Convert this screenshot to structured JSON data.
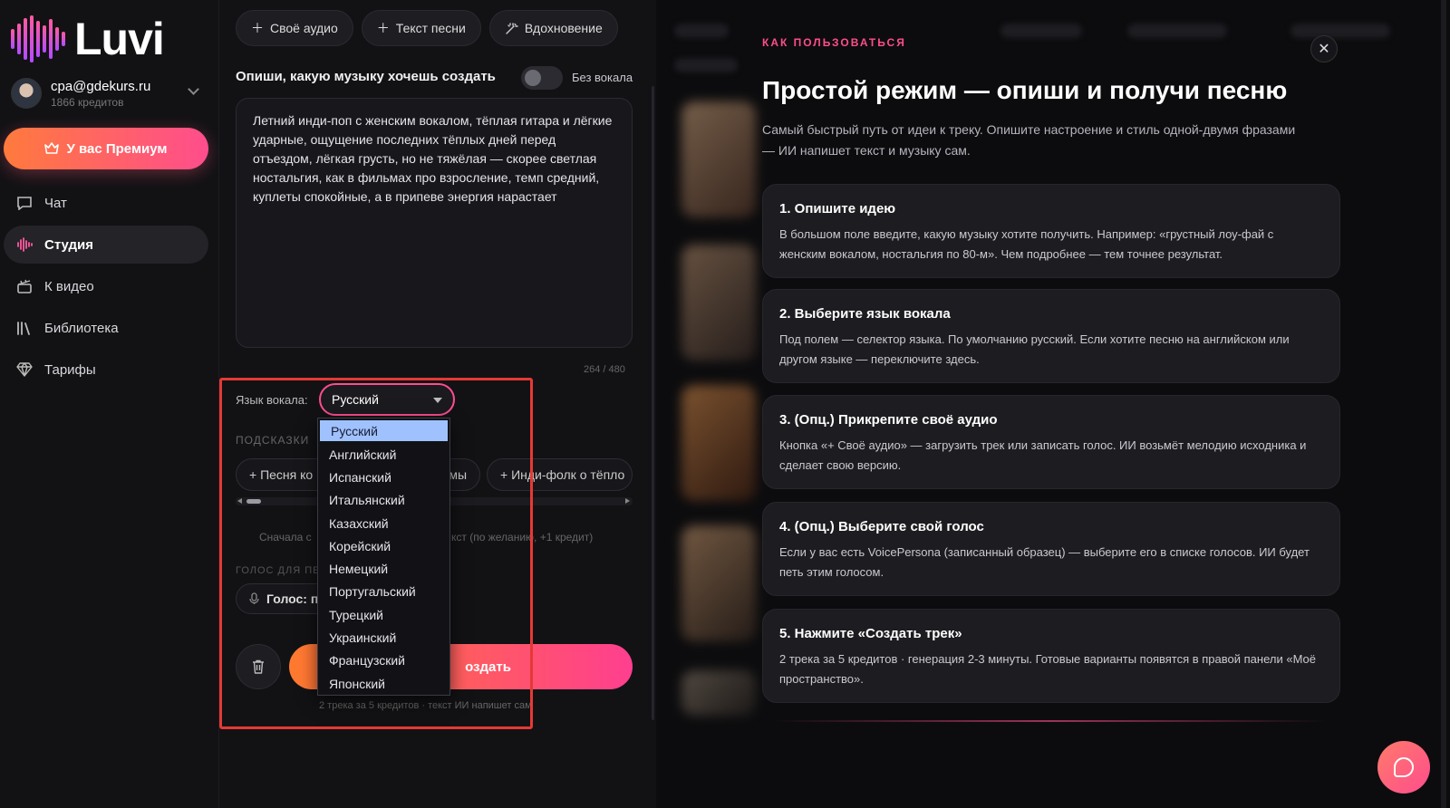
{
  "app": {
    "logo_text": "Luvi"
  },
  "account": {
    "email": "cpa@gdekurs.ru",
    "credits": "1866 кредитов"
  },
  "premium_button": {
    "label": "У вас Премиум",
    "icon": "crown-icon"
  },
  "nav": [
    {
      "label": "Чат",
      "icon": "chat-icon",
      "active": false
    },
    {
      "label": "Студия",
      "icon": "waveform-icon",
      "active": true
    },
    {
      "label": "К видео",
      "icon": "clapperboard-icon",
      "active": false
    },
    {
      "label": "Библиотека",
      "icon": "library-icon",
      "active": false
    },
    {
      "label": "Тарифы",
      "icon": "diamond-icon",
      "active": false
    }
  ],
  "editor": {
    "top_buttons": [
      {
        "label": "Своё аудио",
        "icon": "plus-icon"
      },
      {
        "label": "Текст песни",
        "icon": "plus-icon"
      },
      {
        "label": "Вдохновение",
        "icon": "magic-wand-icon"
      }
    ],
    "prompt_label": "Опиши, какую музыку хочешь создать",
    "no_vocal_label": "Без вокала",
    "no_vocal_enabled": false,
    "prompt_value": "Летний инди-поп с женским вокалом, тёплая гитара и лёгкие ударные, ощущение последних тёплых дней перед отъездом, лёгкая грусть, но не тяжёлая — скорее светлая ностальгия, как в фильмах про взросление, темп средний, куплеты спокойные, а в припеве энергия нарастает",
    "counter": "264 / 480",
    "vocal_lang_label": "Язык вокала:",
    "vocal_lang_selected": "Русский",
    "vocal_lang_options": [
      "Русский",
      "Английский",
      "Испанский",
      "Итальянский",
      "Казахский",
      "Корейский",
      "Немецкий",
      "Португальский",
      "Турецкий",
      "Украинский",
      "Французский",
      "Японский"
    ],
    "hints_title": "ПОДСКАЗКИ",
    "hint_pills": [
      "+ Песня ко",
      "мы",
      "+ Инди-фолк о тёпло"
    ],
    "hint_text_left": "Сначала с",
    "hint_text_right": "кст (по желанию, +1 кредит)",
    "voice_title": "ГОЛОС ДЛЯ ПЕ",
    "voice_pill": "Голос: по",
    "create_button": "оздать",
    "create_note": "2 трека за 5 кредитов · текст ИИ напишет сам"
  },
  "howto": {
    "kicker": "КАК ПОЛЬЗОВАТЬСЯ",
    "title": "Простой режим — опиши и получи песню",
    "subtitle": "Самый быстрый путь от идеи к треку. Опишите настроение и стиль одной-двумя фразами — ИИ напишет текст и музыку сам.",
    "steps": [
      {
        "title": "1. Опишите идею",
        "text": "В большом поле введите, какую музыку хотите получить. Например: «грустный лоу-фай с женским вокалом, ностальгия по 80-м». Чем подробнее — тем точнее результат."
      },
      {
        "title": "2. Выберите язык вокала",
        "text": "Под полем — селектор языка. По умолчанию русский. Если хотите песню на английском или другом языке — переключите здесь."
      },
      {
        "title": "3. (Опц.) Прикрепите своё аудио",
        "text": "Кнопка «+ Своё аудио» — загрузить трек или записать голос. ИИ возьмёт мелодию исходника и сделает свою версию."
      },
      {
        "title": "4. (Опц.) Выберите свой голос",
        "text": "Если у вас есть VoicePersona (записанный образец) — выберите его в списке голосов. ИИ будет петь этим голосом."
      },
      {
        "title": "5. Нажмите «Создать трек»",
        "text": "2 трека за 5 кредитов · генерация 2-3 минуты. Готовые варианты появятся в правой панели «Моё пространство»."
      }
    ]
  },
  "colors": {
    "accent": "#ff4d8d",
    "accent_orange": "#ff7a3d",
    "highlight_frame": "#e53935"
  }
}
